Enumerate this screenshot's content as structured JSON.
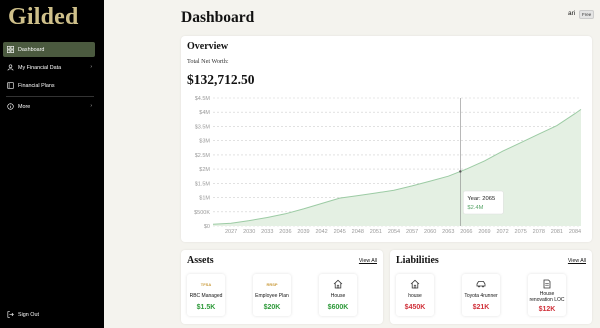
{
  "app": {
    "brand": "Gilded",
    "page_title": "Dashboard"
  },
  "user": {
    "name": "ari",
    "plan_badge": "Free"
  },
  "sidebar": {
    "items": [
      {
        "label": "Dashboard",
        "icon": "grid-icon",
        "active": true,
        "has_chevron": false
      },
      {
        "label": "My Financial Data",
        "icon": "user-icon",
        "active": false,
        "has_chevron": true
      },
      {
        "label": "Financial Plans",
        "icon": "book-icon",
        "active": false,
        "has_chevron": false
      },
      {
        "label": "More",
        "icon": "info-icon",
        "active": false,
        "has_chevron": true
      }
    ],
    "sign_out": "Sign Out"
  },
  "overview": {
    "title": "Overview",
    "subtitle": "Total Net Worth:",
    "net_worth": "$132,712.50",
    "tooltip": {
      "year": "Year: 2065",
      "value": "$2.4M"
    }
  },
  "chart_data": {
    "type": "area",
    "x": [
      2024,
      2027,
      2030,
      2033,
      2036,
      2039,
      2042,
      2045,
      2048,
      2051,
      2054,
      2057,
      2060,
      2063,
      2066,
      2069,
      2072,
      2075,
      2078,
      2081,
      2084,
      2085
    ],
    "y": [
      0.06,
      0.1,
      0.19,
      0.3,
      0.43,
      0.6,
      0.79,
      0.98,
      1.07,
      1.16,
      1.26,
      1.41,
      1.58,
      1.75,
      2.0,
      2.29,
      2.63,
      2.93,
      3.23,
      3.53,
      3.95,
      4.1
    ],
    "x_tick_labels": [
      "2027",
      "2030",
      "2033",
      "2036",
      "2039",
      "2042",
      "2045",
      "2048",
      "2051",
      "2054",
      "2057",
      "2060",
      "2063",
      "2066",
      "2069",
      "2072",
      "2075",
      "2078",
      "2081",
      "2084"
    ],
    "y_tick_labels": [
      "$0",
      "$500K",
      "$1M",
      "$1.5M",
      "$2M",
      "$2.5M",
      "$3M",
      "$3.5M",
      "$4M",
      "$4.5M"
    ],
    "y_ticks": [
      0,
      0.5,
      1,
      1.5,
      2,
      2.5,
      3,
      3.5,
      4,
      4.5
    ],
    "ylim": [
      0,
      4.5
    ],
    "xlim": [
      2024,
      2085
    ],
    "grid": true,
    "highlight_x": 2065,
    "colors": {
      "line": "#9ccba4",
      "fill": "#e4f0e3",
      "grid": "#cfcfcf",
      "tick": "#9a9a9a",
      "hover_line": "#888888"
    }
  },
  "assets": {
    "title": "Assets",
    "view_all": "View All",
    "items": [
      {
        "icon_text": "TFSA",
        "icon": "tfsa-logo-icon",
        "label": "RBC Managed",
        "value": "$1.5K"
      },
      {
        "icon_text": "RRSP",
        "icon": "rrsp-logo-icon",
        "label": "Employee Plan",
        "value": "$20K"
      },
      {
        "icon_text": "",
        "icon": "house-icon",
        "label": "House",
        "value": "$600K"
      }
    ]
  },
  "liabilities": {
    "title": "Liabilities",
    "view_all": "View All",
    "items": [
      {
        "icon": "house-icon",
        "label": "house",
        "value": "$450K"
      },
      {
        "icon": "car-icon",
        "label": "Toyota 4runner",
        "value": "$21K"
      },
      {
        "icon": "document-icon",
        "label": "House renovation LOC",
        "value": "$12K"
      }
    ]
  },
  "colors": {
    "brand": "#cfc08a",
    "sidebar_active": "#4b5a3f",
    "positive": "#2e9a3a",
    "negative": "#d0313a"
  }
}
